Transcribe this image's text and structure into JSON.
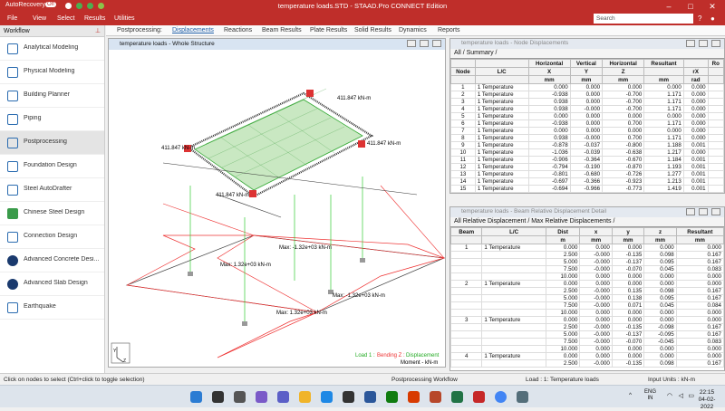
{
  "app": {
    "title": "temperature loads.STD - STAAD.Pro CONNECT Edition",
    "autorecovery": "AutoRecovery",
    "toggle": "Off"
  },
  "menu": [
    "File",
    "View",
    "Select",
    "Results",
    "Utilities"
  ],
  "search_placeholder": "Search",
  "workflow": {
    "header": "Workflow",
    "items": [
      "Analytical Modeling",
      "Physical Modeling",
      "Building Planner",
      "Piping",
      "Postprocessing",
      "Foundation Design",
      "Steel AutoDrafter",
      "Chinese Steel Design",
      "Connection Design",
      "Advanced Concrete Desi...",
      "Advanced Slab Design",
      "Earthquake"
    ],
    "active_index": 4
  },
  "pp_tabs": {
    "label": "Postprocessing:",
    "tabs": [
      "Displacements",
      "Reactions",
      "Beam Results",
      "Plate Results",
      "Solid Results",
      "Dynamics",
      "Reports"
    ],
    "selected": 0
  },
  "graphics": {
    "title": "temperature loads - Whole Structure",
    "labels": [
      "411.847 kN-m",
      "411.847 kN-m",
      "411.847 kN-m",
      "411.847 kN-m",
      "Max: -1.32e+03 kN-m",
      "Max: 1.32e+03 kN-m",
      "Max: -1.32e+03 kN-m",
      "Max: 1.32e+03 kN-m"
    ],
    "legend": {
      "load": "Load 1 :",
      "bending": "Bending Z :",
      "displacement": "Displacement",
      "moment": "Moment - kN-m"
    },
    "axis": {
      "y": "Y",
      "z": "Z"
    }
  },
  "node_disp": {
    "title": "temperature loads - Node Displacements",
    "tabs": [
      "All",
      "Summary"
    ],
    "head1": [
      "",
      "",
      "Horizontal",
      "Vertical",
      "Horizontal",
      "Resultant",
      "",
      "Ro"
    ],
    "head2": [
      "Node",
      "L/C",
      "X",
      "Y",
      "Z",
      "",
      "rX",
      ""
    ],
    "units": [
      "",
      "",
      "mm",
      "mm",
      "mm",
      "mm",
      "rad",
      ""
    ],
    "rows": [
      [
        "1",
        "1 Temperature",
        "0.000",
        "0.000",
        "0.000",
        "0.000",
        "0.000"
      ],
      [
        "2",
        "1 Temperature",
        "-0.938",
        "0.000",
        "-0.700",
        "1.171",
        "0.000"
      ],
      [
        "3",
        "1 Temperature",
        "0.938",
        "0.000",
        "-0.700",
        "1.171",
        "0.000"
      ],
      [
        "4",
        "1 Temperature",
        "0.938",
        "-0.000",
        "-0.700",
        "1.171",
        "0.000"
      ],
      [
        "5",
        "1 Temperature",
        "0.000",
        "0.000",
        "0.000",
        "0.000",
        "0.000"
      ],
      [
        "6",
        "1 Temperature",
        "-0.938",
        "0.000",
        "0.700",
        "1.171",
        "0.000"
      ],
      [
        "7",
        "1 Temperature",
        "0.000",
        "0.000",
        "0.000",
        "0.000",
        "0.000"
      ],
      [
        "8",
        "1 Temperature",
        "0.938",
        "-0.000",
        "0.700",
        "1.171",
        "0.000"
      ],
      [
        "9",
        "1 Temperature",
        "-0.878",
        "-0.037",
        "-0.800",
        "1.188",
        "0.001"
      ],
      [
        "10",
        "1 Temperature",
        "-1.036",
        "-0.039",
        "-0.638",
        "1.217",
        "0.000"
      ],
      [
        "11",
        "1 Temperature",
        "-0.906",
        "-0.364",
        "-0.670",
        "1.184",
        "0.001"
      ],
      [
        "12",
        "1 Temperature",
        "-0.794",
        "-0.190",
        "-0.870",
        "1.193",
        "0.001"
      ],
      [
        "13",
        "1 Temperature",
        "-0.801",
        "-0.680",
        "-0.726",
        "1.277",
        "0.001"
      ],
      [
        "14",
        "1 Temperature",
        "-0.697",
        "-0.366",
        "-0.923",
        "1.213",
        "0.001"
      ],
      [
        "15",
        "1 Temperature",
        "-0.694",
        "-0.966",
        "-0.773",
        "1.419",
        "0.001"
      ]
    ]
  },
  "beam_disp": {
    "title": "temperature loads - Beam Relative Displacement Detail",
    "tabs": [
      "All Relative Displacement",
      "Max Relative Displacements"
    ],
    "head": [
      "Beam",
      "L/C",
      "Dist",
      "x",
      "y",
      "z",
      "Resultant"
    ],
    "units": [
      "",
      "",
      "m",
      "mm",
      "mm",
      "mm",
      "mm"
    ],
    "rows": [
      [
        "1",
        "1 Temperature",
        "0.000",
        "0.000",
        "0.000",
        "0.000",
        "0.000"
      ],
      [
        "",
        "",
        "2.500",
        "-0.000",
        "-0.135",
        "0.098",
        "0.167"
      ],
      [
        "",
        "",
        "5.000",
        "-0.000",
        "-0.137",
        "0.095",
        "0.167"
      ],
      [
        "",
        "",
        "7.500",
        "-0.000",
        "-0.070",
        "0.045",
        "0.083"
      ],
      [
        "",
        "",
        "10.000",
        "0.000",
        "0.000",
        "0.000",
        "0.000"
      ],
      [
        "2",
        "1 Temperature",
        "0.000",
        "0.000",
        "0.000",
        "0.000",
        "0.000"
      ],
      [
        "",
        "",
        "2.500",
        "-0.000",
        "0.135",
        "0.098",
        "0.167"
      ],
      [
        "",
        "",
        "5.000",
        "-0.000",
        "0.138",
        "0.095",
        "0.167"
      ],
      [
        "",
        "",
        "7.500",
        "-0.000",
        "0.071",
        "0.045",
        "0.084"
      ],
      [
        "",
        "",
        "10.000",
        "0.000",
        "0.000",
        "0.000",
        "0.000"
      ],
      [
        "3",
        "1 Temperature",
        "0.000",
        "0.000",
        "0.000",
        "0.000",
        "0.000"
      ],
      [
        "",
        "",
        "2.500",
        "-0.000",
        "-0.135",
        "-0.098",
        "0.167"
      ],
      [
        "",
        "",
        "5.000",
        "-0.000",
        "-0.137",
        "-0.095",
        "0.167"
      ],
      [
        "",
        "",
        "7.500",
        "-0.000",
        "-0.070",
        "-0.045",
        "0.083"
      ],
      [
        "",
        "",
        "10.000",
        "0.000",
        "0.000",
        "0.000",
        "0.000"
      ],
      [
        "4",
        "1 Temperature",
        "0.000",
        "0.000",
        "0.000",
        "0.000",
        "0.000"
      ],
      [
        "",
        "",
        "2.500",
        "-0.000",
        "-0.135",
        "0.098",
        "0.167"
      ]
    ]
  },
  "status": {
    "left": "Click on nodes to select (Ctrl+click to toggle selection)",
    "workflow": "Postprocessing Workflow",
    "load": "Load : 1: Temperature loads",
    "units": "Input Units : kN-m"
  },
  "tray": {
    "lang": "ENG",
    "region": "IN",
    "time": "22:15",
    "date": "04-02-2022"
  },
  "colors": {
    "brand": "#bf2e2a",
    "accent": "#1f5fa8"
  }
}
